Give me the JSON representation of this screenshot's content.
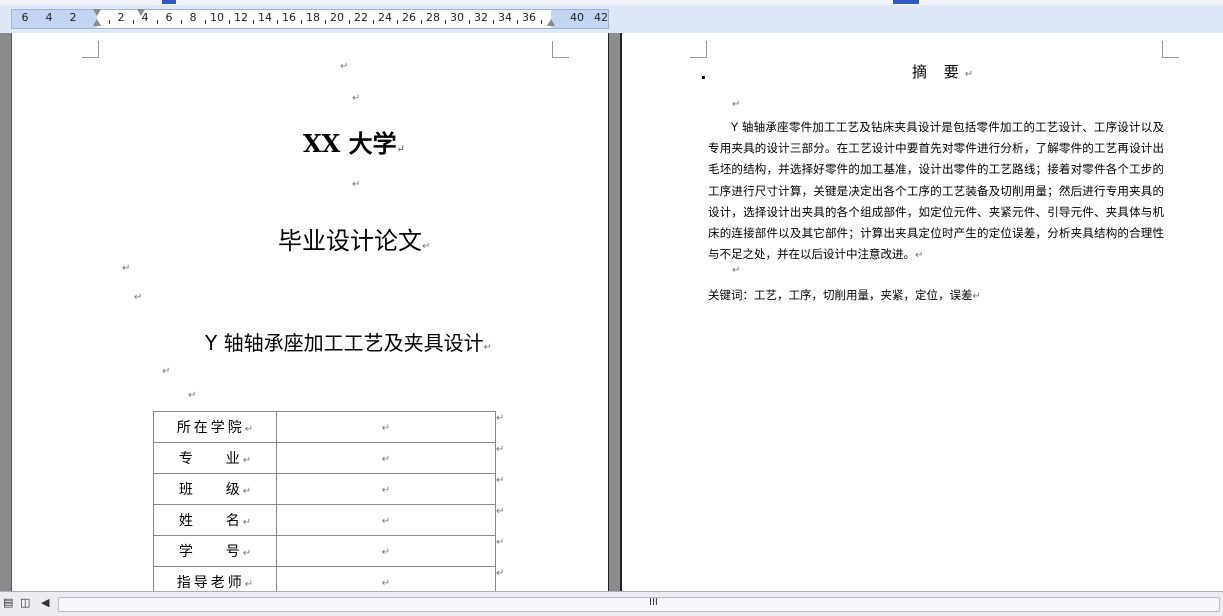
{
  "ruler": {
    "left_numbers": [
      "6",
      "4",
      "2"
    ],
    "numbers": [
      "2",
      "4",
      "6",
      "8",
      "10",
      "12",
      "14",
      "16",
      "18",
      "20",
      "22",
      "24",
      "26",
      "28",
      "30",
      "32",
      "34",
      "36"
    ],
    "right_numbers": [
      "40",
      "42"
    ]
  },
  "marks": {
    "para": "↵"
  },
  "cover": {
    "university": "XX 大学",
    "doc_type": "毕业设计论文",
    "thesis_title": "Y 轴轴承座加工工艺及夹具设计",
    "table": [
      {
        "label": "所在学院",
        "value": ""
      },
      {
        "label": "专    业",
        "value": ""
      },
      {
        "label": "班    级",
        "value": ""
      },
      {
        "label": "姓    名",
        "value": ""
      },
      {
        "label": "学    号",
        "value": ""
      },
      {
        "label": "指导老师",
        "value": ""
      }
    ]
  },
  "abstract": {
    "title": "摘 要",
    "body": "Y 轴轴承座零件加工工艺及钻床夹具设计是包括零件加工的工艺设计、工序设计以及专用夹具的设计三部分。在工艺设计中要首先对零件进行分析，了解零件的工艺再设计出毛坯的结构，并选择好零件的加工基准，设计出零件的工艺路线；接着对零件各个工步的工序进行尺寸计算，关键是决定出各个工序的工艺装备及切削用量；然后进行专用夹具的设计，选择设计出夹具的各个组成部件，如定位元件、夹紧元件、引导元件、夹具体与机床的连接部件以及其它部件；计算出夹具定位时产生的定位误差，分析夹具结构的合理性与不足之处，并在以后设计中注意改进。",
    "keywords": "关键词：工艺，工序，切削用量，夹紧，定位，误差"
  },
  "statusbar": {
    "grip": "III"
  }
}
